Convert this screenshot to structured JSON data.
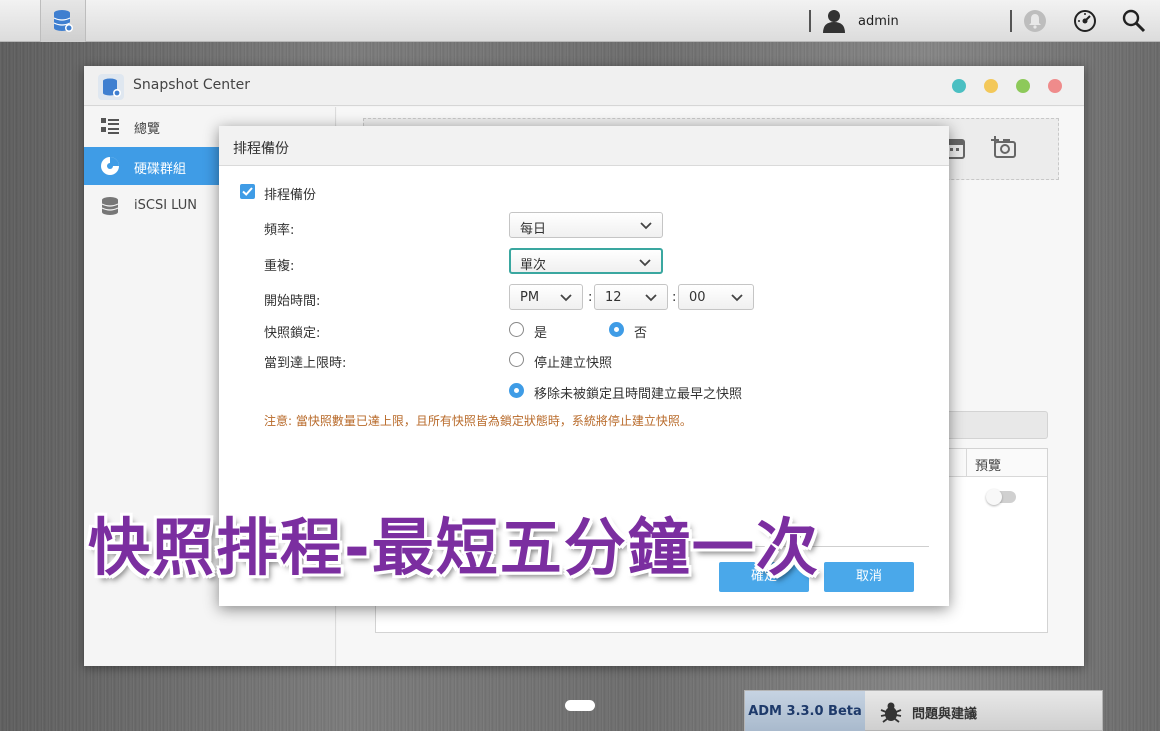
{
  "topbar": {
    "user_name": "admin"
  },
  "window": {
    "title": "Snapshot Center",
    "dots": [
      "#4bbfc2",
      "#f3c85a",
      "#8dc95a",
      "#ef8b8b"
    ]
  },
  "sidebar": {
    "items": [
      {
        "label": "總覽",
        "icon": "overview-icon"
      },
      {
        "label": "硬碟群組",
        "icon": "volume-icon"
      },
      {
        "label": "iSCSI LUN",
        "icon": "database-icon"
      }
    ]
  },
  "table": {
    "col_preview": "預覽"
  },
  "dialog": {
    "title": "排程備份",
    "enable_label": "排程備份",
    "frequency_label": "頻率:",
    "frequency_value": "每日",
    "repeat_label": "重複:",
    "repeat_value": "單次",
    "start_time_label": "開始時間:",
    "start_ampm": "PM",
    "start_hour": "12",
    "start_minute": "00",
    "lock_label": "快照鎖定:",
    "lock_yes": "是",
    "lock_no": "否",
    "limit_label": "當到達上限時:",
    "limit_option1": "停止建立快照",
    "limit_option2": "移除未被鎖定且時間建立最早之快照",
    "note": "注意: 當快照數量已達上限，且所有快照皆為鎖定狀態時，系統將停止建立快照。",
    "ok_label": "確定",
    "cancel_label": "取消"
  },
  "overlay_caption": "快照排程-最短五分鐘一次",
  "bottom": {
    "version": "ADM 3.3.0 Beta",
    "feedback": "問題與建議"
  },
  "colors": {
    "accent": "#3f9ce6",
    "note": "#b86a2a",
    "caption": "#7b2ea0"
  }
}
